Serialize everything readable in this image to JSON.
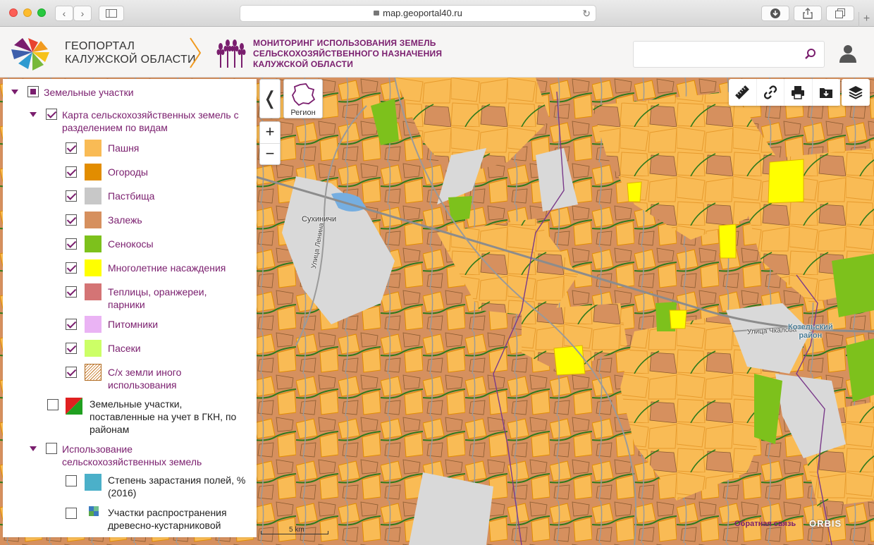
{
  "browser": {
    "url": "map.geoportal40.ru",
    "reload_icon": "reload-icon",
    "new_tab": "+"
  },
  "header": {
    "portal_name_line1": "ГЕОПОРТАЛ",
    "portal_name_line2": "КАЛУЖСКОЙ ОБЛАСТИ",
    "project_title_line1": "МОНИТОРИНГ ИСПОЛЬЗОВАНИЯ ЗЕМЕЛЬ",
    "project_title_line2": "СЕЛЬСКОХОЗЯЙСТВЕННОГО НАЗНАЧЕНИЯ",
    "project_title_line3": "КАЛУЖСКОЙ ОБЛАСТИ",
    "search_placeholder": "",
    "accent_color": "#7a1e6e"
  },
  "map": {
    "region_button_label": "Регион",
    "collapse_label": "❬",
    "zoom_in_label": "+",
    "zoom_out_label": "−",
    "labels": {
      "town": "Сухиничи",
      "street_lenina": "Улица Ленина",
      "street_chkalova": "Улица Чкалова",
      "district_line1": "Козельский",
      "district_line2": "район"
    },
    "scale_label": "5 km",
    "feedback_link": "Обратная связь",
    "brand": "ORBIS",
    "toolbar_icons": [
      "ruler-icon",
      "link-icon",
      "print-icon",
      "download-icon"
    ],
    "layers_icon": "layers-icon"
  },
  "legend": {
    "group_land": "Земельные участки",
    "subgroup_agri_map": "Карта сельскохозяйственных земель с разделением по видам",
    "items": [
      {
        "label": "Пашня",
        "color": "#f9bb55"
      },
      {
        "label": "Огороды",
        "color": "#e28d00"
      },
      {
        "label": "Пастбища",
        "color": "#c8c8c8"
      },
      {
        "label": "Залежь",
        "color": "#d6905e"
      },
      {
        "label": "Сенокосы",
        "color": "#7dc11c"
      },
      {
        "label": "Многолетние насаждения",
        "color": "#ffff00"
      },
      {
        "label": "Теплицы, оранжереи, парники",
        "color": "#d47475"
      },
      {
        "label": "Питомники",
        "color": "#eab3f4"
      },
      {
        "label": "Пасеки",
        "color": "#ccff66"
      },
      {
        "label": "С/х земли иного использования",
        "color": "#f1d3a5"
      }
    ],
    "gkn_layer": "Земельные участки, поставленные на учет в ГКН, по районам",
    "group_usage": "Использование сельскохозяйственных земель",
    "overgrowth_layer": "Степень зарастания полей, % (2016)",
    "overgrowth_color": "#4bb0c9",
    "shrub_layer": "Участки распространения древесно-кустарниковой"
  }
}
